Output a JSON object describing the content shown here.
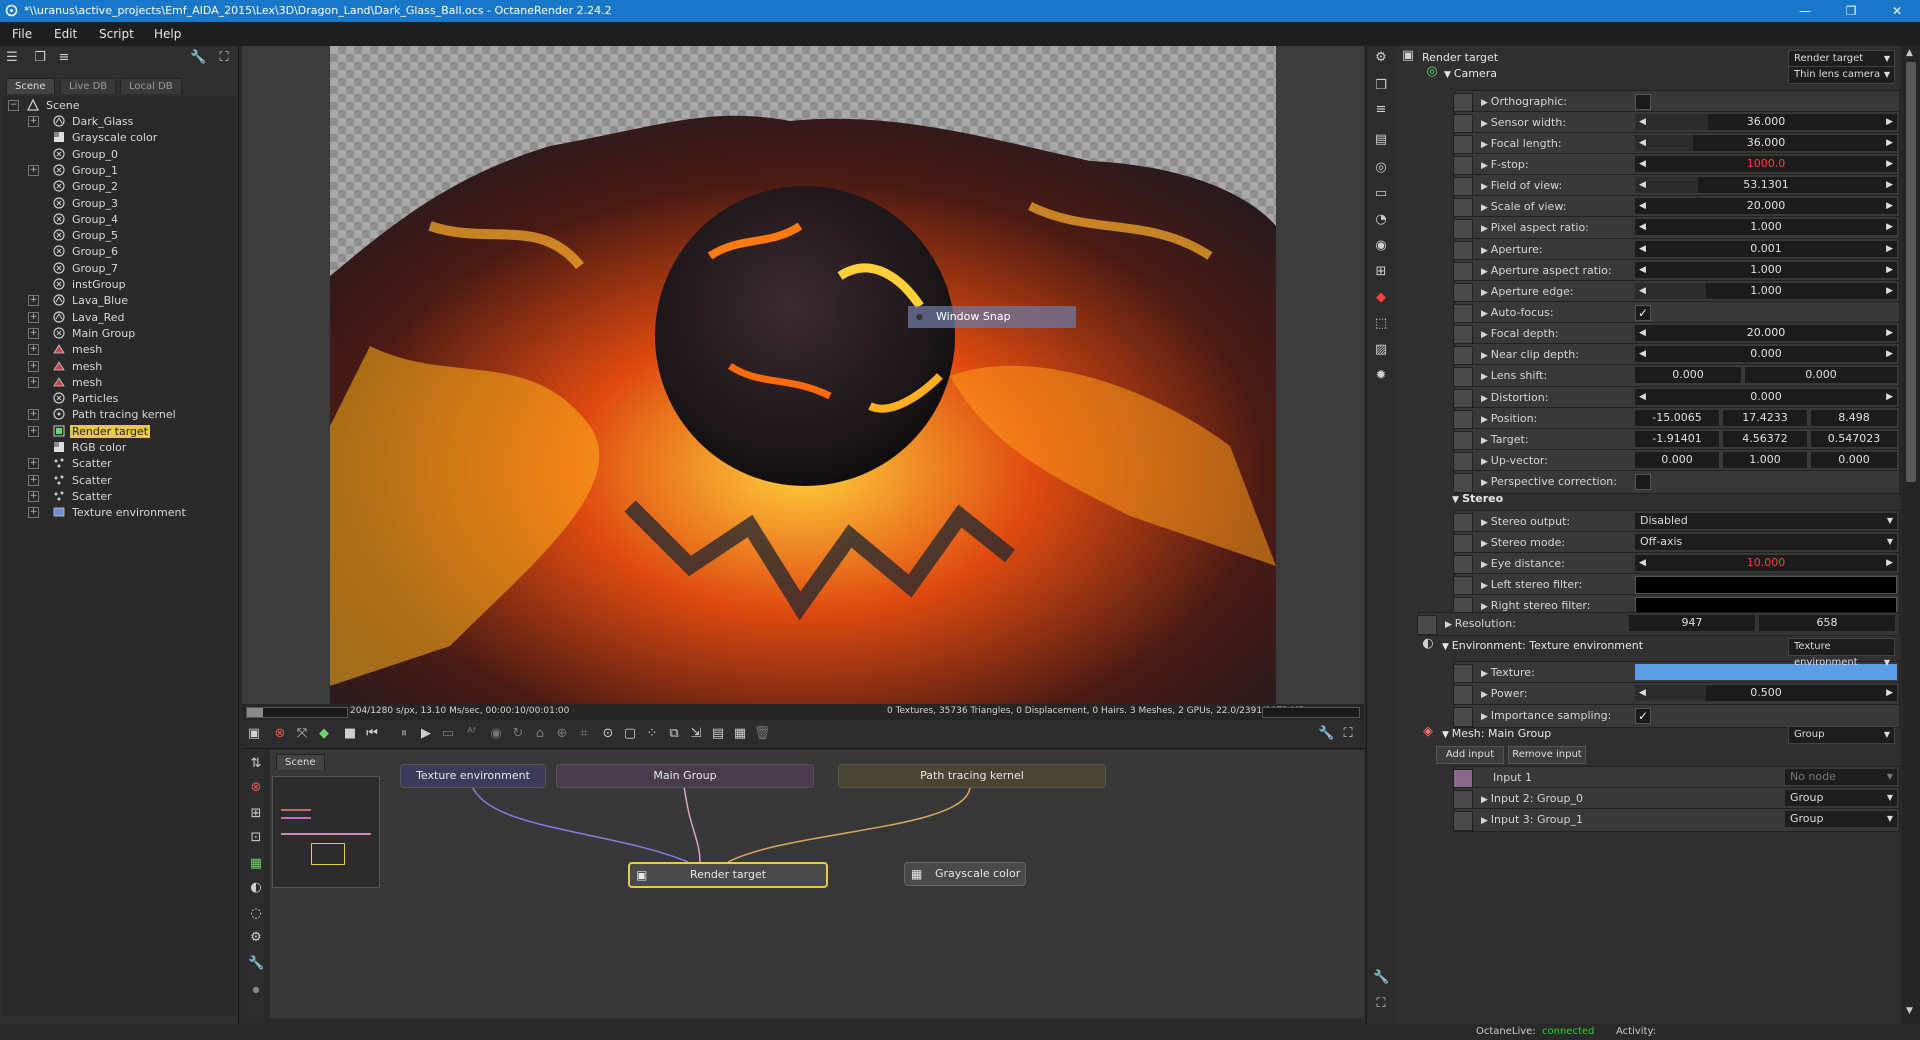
{
  "window": {
    "title": "*\\\\uranus\\active_projects\\Emf_AIDA_2015\\Lex\\3D\\Dragon_Land\\Dark_Glass_Ball.ocs - OctaneRender 2.24.2",
    "minimize": "—",
    "maximize": "❐",
    "close": "✕"
  },
  "menu": [
    "File",
    "Edit",
    "Script",
    "Help"
  ],
  "left_tabs": [
    "Scene",
    "Live DB",
    "Local DB"
  ],
  "tree": {
    "root": "Scene",
    "items": [
      {
        "label": "Dark_Glass",
        "expandable": true,
        "icon": "material-icon"
      },
      {
        "label": "Grayscale color",
        "expandable": false,
        "icon": "texture-icon"
      },
      {
        "label": "Group_0",
        "expandable": false,
        "icon": "group-icon"
      },
      {
        "label": "Group_1",
        "expandable": true,
        "icon": "group-icon"
      },
      {
        "label": "Group_2",
        "expandable": false,
        "icon": "group-icon"
      },
      {
        "label": "Group_3",
        "expandable": false,
        "icon": "group-icon"
      },
      {
        "label": "Group_4",
        "expandable": false,
        "icon": "group-icon"
      },
      {
        "label": "Group_5",
        "expandable": false,
        "icon": "group-icon"
      },
      {
        "label": "Group_6",
        "expandable": false,
        "icon": "group-icon"
      },
      {
        "label": "Group_7",
        "expandable": false,
        "icon": "group-icon"
      },
      {
        "label": "instGroup",
        "expandable": false,
        "icon": "group-icon"
      },
      {
        "label": "Lava_Blue",
        "expandable": true,
        "icon": "material-icon"
      },
      {
        "label": "Lava_Red",
        "expandable": true,
        "icon": "material-icon"
      },
      {
        "label": "Main Group",
        "expandable": true,
        "icon": "group-icon"
      },
      {
        "label": "mesh",
        "expandable": true,
        "icon": "mesh-icon"
      },
      {
        "label": "mesh",
        "expandable": true,
        "icon": "mesh-icon"
      },
      {
        "label": "mesh",
        "expandable": true,
        "icon": "mesh-icon"
      },
      {
        "label": "Particles",
        "expandable": false,
        "icon": "group-icon"
      },
      {
        "label": "Path tracing kernel",
        "expandable": true,
        "icon": "kernel-icon"
      },
      {
        "label": "Render target",
        "expandable": true,
        "icon": "render-target-icon",
        "selected": true
      },
      {
        "label": "RGB color",
        "expandable": false,
        "icon": "texture-icon"
      },
      {
        "label": "Scatter",
        "expandable": true,
        "icon": "scatter-icon"
      },
      {
        "label": "Scatter",
        "expandable": true,
        "icon": "scatter-icon"
      },
      {
        "label": "Scatter",
        "expandable": true,
        "icon": "scatter-icon"
      },
      {
        "label": "Texture environment",
        "expandable": true,
        "icon": "environment-icon"
      }
    ]
  },
  "viewport": {
    "snap_label": "Window Snap",
    "status_left": "204/1280 s/px, 13.10 Ms/sec, 00:00:10/00:01:00",
    "status_right": "0 Textures, 35736 Triangles, 0 Displacement, 0 Hairs. 3 Meshes, 2 GPUs, 22.0/2391/3072 MB",
    "progress": 0.16
  },
  "graph": {
    "tab": "Scene",
    "nodes": {
      "texture_env": "Texture environment",
      "main_group": "Main Group",
      "path_tracing": "Path tracing kernel",
      "render_target": "Render target",
      "grayscale": "Grayscale color"
    }
  },
  "inspector": {
    "header_title": "Render target",
    "header_dropdown": "Render target",
    "camera_title": "Camera",
    "camera_dropdown": "Thin lens camera",
    "rows": {
      "orthographic": {
        "label": "Orthographic:"
      },
      "sensor_width": {
        "label": "Sensor width:",
        "value": "36.000",
        "fill": 0.28
      },
      "focal_length": {
        "label": "Focal length:",
        "value": "36.000",
        "fill": 0.22
      },
      "fstop": {
        "label": "F-stop:",
        "value": "1000.0",
        "fill": 0.0
      },
      "fov": {
        "label": "Field of view:",
        "value": "53.1301",
        "fill": 0.24
      },
      "scale_of_view": {
        "label": "Scale of view:",
        "value": "20.000",
        "fill": 0.0
      },
      "pixel_aspect": {
        "label": "Pixel aspect ratio:",
        "value": "1.000",
        "fill": 0.0
      },
      "aperture": {
        "label": "Aperture:",
        "value": "0.001",
        "fill": 0.0
      },
      "aperture_aspect": {
        "label": "Aperture aspect ratio:",
        "value": "1.000",
        "fill": 0.0
      },
      "aperture_edge": {
        "label": "Aperture edge:",
        "value": "1.000",
        "fill": 0.27
      },
      "autofocus": {
        "label": "Auto-focus:",
        "check": "✓"
      },
      "focal_depth": {
        "label": "Focal depth:",
        "value": "20.000",
        "fill": 0.0
      },
      "near_clip": {
        "label": "Near clip depth:",
        "value": "0.000",
        "fill": 0.0
      },
      "lens_shift": {
        "label": "Lens shift:",
        "v1": "0.000",
        "v2": "0.000"
      },
      "distortion": {
        "label": "Distortion:",
        "value": "0.000",
        "fill": 0.0
      },
      "position": {
        "label": "Position:",
        "v1": "-15.0065",
        "v2": "17.4233",
        "v3": "8.498"
      },
      "target": {
        "label": "Target:",
        "v1": "-1.91401",
        "v2": "4.56372",
        "v3": "0.547023"
      },
      "up_vector": {
        "label": "Up-vector:",
        "v1": "0.000",
        "v2": "1.000",
        "v3": "0.000"
      },
      "perspective": {
        "label": "Perspective correction:"
      },
      "stereo_output": {
        "label": "Stereo output:",
        "value": "Disabled"
      },
      "stereo_mode": {
        "label": "Stereo mode:",
        "value": "Off-axis"
      },
      "eye_distance": {
        "label": "Eye distance:",
        "value": "10.000",
        "fill": 0.0
      },
      "left_filter": {
        "label": "Left stereo filter:"
      },
      "right_filter": {
        "label": "Right stereo filter:"
      },
      "texture": {
        "label": "Texture:"
      },
      "power": {
        "label": "Power:",
        "value": "0.500",
        "fill": 0.27
      },
      "importance": {
        "label": "Importance sampling:",
        "check": "✓"
      },
      "input1": {
        "label": "Input 1",
        "value": "No node"
      },
      "input2": {
        "label": "Input 2: Group_0",
        "value": "Group"
      },
      "input3": {
        "label": "Input 3: Group_1",
        "value": "Group"
      }
    },
    "stereo_title": "Stereo",
    "resolution_label": "Resolution:",
    "resolution_w": "947",
    "resolution_h": "658",
    "environment_title": "Environment: Texture environment",
    "environment_dropdown": "Texture environment",
    "mesh_title": "Mesh: Main Group",
    "mesh_dropdown": "Group",
    "add_input": "Add input",
    "remove_input": "Remove input"
  },
  "footer": {
    "live_label": "OctaneLive:",
    "live_status": "connected",
    "activity_label": "Activity:"
  },
  "colors": {
    "titlebar": "#1877c9",
    "connected": "#2fd12f",
    "fstop_value": "#ff3b3b",
    "selection": "#e8c94a",
    "texture_swatch": "#5b9ee6"
  }
}
